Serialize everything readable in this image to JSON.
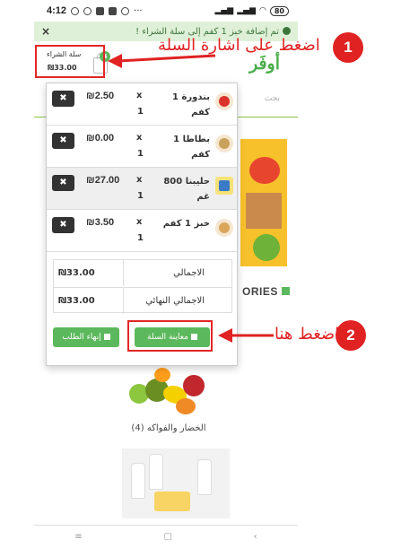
{
  "status": {
    "time": "4:12",
    "battery": "80"
  },
  "alert": {
    "message": "تم إضافة خبز 1 كفم إلى سلة الشراء !",
    "close": "×"
  },
  "header": {
    "cart_label": "سلة الشراء",
    "cart_total": "₪33.00",
    "badge": "4",
    "logo": "أوفَر"
  },
  "search": {
    "placeholder": "بحث"
  },
  "categories_title": "ORIES",
  "cart": {
    "items": [
      {
        "name": "بندورة 1 كفم",
        "qty_symbol": "x",
        "qty": "1",
        "price": "₪2.50",
        "remove": "✖",
        "icon": "tomato-icon"
      },
      {
        "name": "بطاطا 1 كفم",
        "qty_symbol": "x",
        "qty": "1",
        "price": "₪0.00",
        "remove": "✖",
        "icon": "potato-icon"
      },
      {
        "name": "حليبنا 800 غم",
        "qty_symbol": "x",
        "qty": "1",
        "price": "₪27.00",
        "remove": "✖",
        "icon": "milk-icon"
      },
      {
        "name": "خبز 1 كفم",
        "qty_symbol": "x",
        "qty": "1",
        "price": "₪3.50",
        "remove": "✖",
        "icon": "bread-icon"
      }
    ],
    "totals": [
      {
        "label": "الاجمالي",
        "value": "₪33.00"
      },
      {
        "label": "الاجمالي النهائي",
        "value": "₪33.00"
      }
    ],
    "view_cart": "معاينة السلة",
    "finish_order": "إنهاء الطلب"
  },
  "category_label": "الخضار والفواكه (4)",
  "annotations": {
    "step1_number": "1",
    "step1_text": "اضغط على اشارة السلة",
    "step2_number": "2",
    "step2_text": "اضغط هنا"
  },
  "colors": {
    "accent": "#5cb85c",
    "annotation": "#e02222"
  }
}
